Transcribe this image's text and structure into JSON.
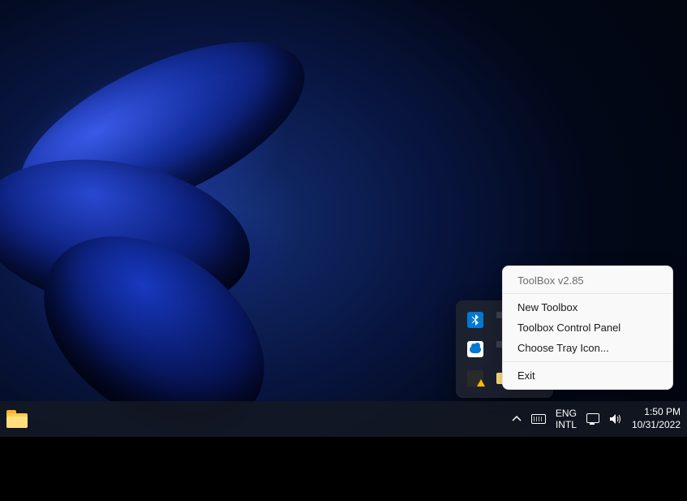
{
  "context_menu": {
    "title": "ToolBox v2.85",
    "items": [
      "New Toolbox",
      "Toolbox Control Panel",
      "Choose Tray Icon..."
    ],
    "exit": "Exit"
  },
  "taskbar": {
    "language": {
      "line1": "ENG",
      "line2": "INTL"
    },
    "clock": {
      "time": "1:50 PM",
      "date": "10/31/2022"
    }
  },
  "tray_icons": [
    "bluetooth",
    "unknown",
    "onedrive",
    "unknown",
    "warning",
    "folder"
  ]
}
